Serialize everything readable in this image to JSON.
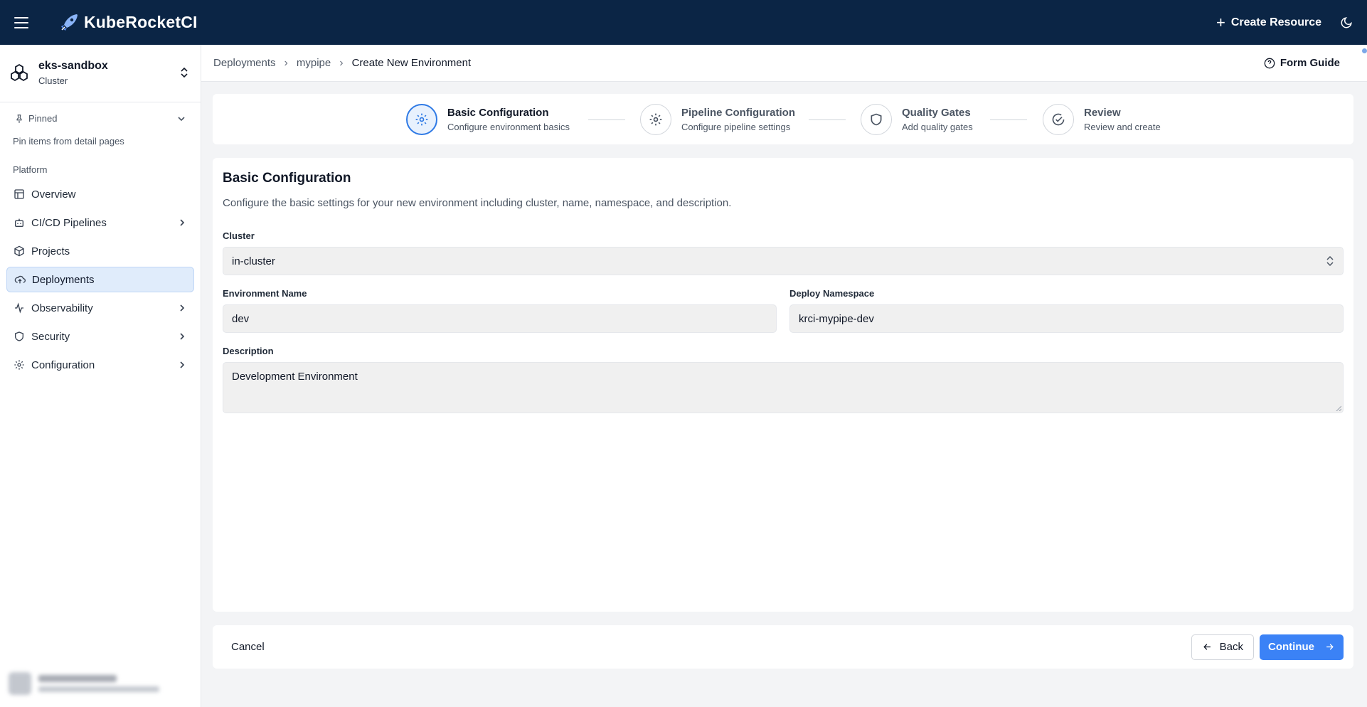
{
  "app": {
    "name": "KubeRocketCI",
    "create_resource_label": "Create Resource"
  },
  "sidebar": {
    "cluster": {
      "name": "eks-sandbox",
      "type": "Cluster"
    },
    "pinned": {
      "label": "Pinned",
      "hint": "Pin items from detail pages"
    },
    "section": "Platform",
    "items": [
      {
        "label": "Overview",
        "icon": "layout-icon",
        "has_submenu": false
      },
      {
        "label": "CI/CD Pipelines",
        "icon": "bot-icon",
        "has_submenu": true
      },
      {
        "label": "Projects",
        "icon": "box-icon",
        "has_submenu": false
      },
      {
        "label": "Deployments",
        "icon": "cloud-upload-icon",
        "has_submenu": false,
        "active": true
      },
      {
        "label": "Observability",
        "icon": "activity-icon",
        "has_submenu": true
      },
      {
        "label": "Security",
        "icon": "shield-icon",
        "has_submenu": true
      },
      {
        "label": "Configuration",
        "icon": "gear-icon",
        "has_submenu": true
      }
    ]
  },
  "header": {
    "breadcrumb": [
      "Deployments",
      "mypipe",
      "Create New Environment"
    ],
    "form_guide_label": "Form Guide"
  },
  "stepper": [
    {
      "title": "Basic Configuration",
      "subtitle": "Configure environment basics",
      "icon": "gear-icon",
      "active": true
    },
    {
      "title": "Pipeline Configuration",
      "subtitle": "Configure pipeline settings",
      "icon": "gear-icon",
      "active": false
    },
    {
      "title": "Quality Gates",
      "subtitle": "Add quality gates",
      "icon": "shield-icon",
      "active": false
    },
    {
      "title": "Review",
      "subtitle": "Review and create",
      "icon": "check-circle-icon",
      "active": false
    }
  ],
  "form": {
    "title": "Basic Configuration",
    "description": "Configure the basic settings for your new environment including cluster, name, namespace, and description.",
    "cluster": {
      "label": "Cluster",
      "value": "in-cluster"
    },
    "env_name": {
      "label": "Environment Name",
      "value": "dev"
    },
    "namespace": {
      "label": "Deploy Namespace",
      "value": "krci-mypipe-dev"
    },
    "description_field": {
      "label": "Description",
      "value": "Development Environment"
    }
  },
  "footer": {
    "cancel_label": "Cancel",
    "back_label": "Back",
    "continue_label": "Continue"
  },
  "colors": {
    "topbar": "#0b2545",
    "accent": "#3b82f6",
    "active_nav_bg": "#e0ecfb"
  }
}
